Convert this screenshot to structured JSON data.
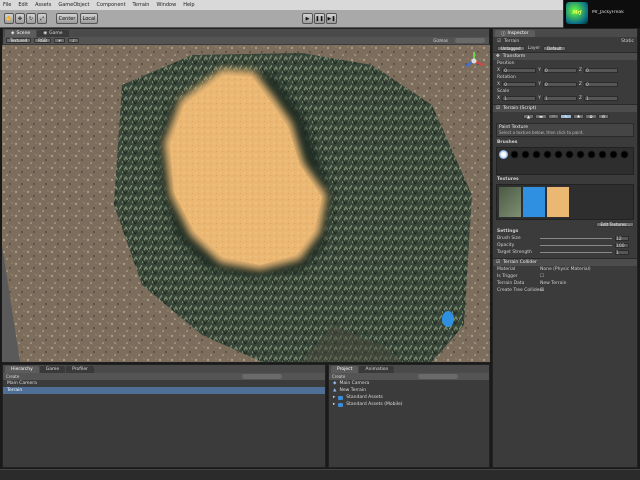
{
  "menu": [
    "File",
    "Edit",
    "Assets",
    "GameObject",
    "Component",
    "Terrain",
    "Window",
    "Help"
  ],
  "toolbar": {
    "tools": [
      "hand",
      "move",
      "rotate",
      "scale"
    ],
    "pivot_label": "Center",
    "space_label": "Local",
    "play_controls": [
      "play",
      "pause",
      "step"
    ]
  },
  "user": {
    "logo_text": "MrJ",
    "name": "Mr_JackyFreak"
  },
  "scene": {
    "tabs": [
      "Scene",
      "Game"
    ],
    "shading_mode": "Textured",
    "render_mode": "RGB",
    "gizmos_label": "Gizmos"
  },
  "inspector": {
    "tab": "Inspector",
    "object_name": "Terrain",
    "static_label": "Static",
    "tag_label": "Untagged",
    "layer_label": "Layer",
    "layer_value": "Default",
    "transform": {
      "title": "Transform",
      "position_label": "Position",
      "rotation_label": "Rotation",
      "scale_label": "Scale",
      "position": {
        "x": "0",
        "y": "0",
        "z": "0"
      },
      "rotation": {
        "x": "0",
        "y": "0",
        "z": "0"
      },
      "scale": {
        "x": "1",
        "y": "1",
        "z": "1"
      }
    },
    "terrain": {
      "title": "Terrain (Script)",
      "paint_heading": "Paint Texture",
      "paint_help": "Select a texture below, then click to paint.",
      "brushes_heading": "Brushes",
      "textures_heading": "Textures",
      "edit_textures": "Edit Textures...",
      "settings_heading": "Settings",
      "brush_size_label": "Brush Size",
      "brush_size": "12",
      "opacity_label": "Opacity",
      "opacity": "100",
      "target_strength_label": "Target Strength",
      "target_strength": "1"
    },
    "collider": {
      "title": "Terrain Collider",
      "material_label": "Material",
      "material_value": "None (Physic Material)",
      "trigger_label": "Is Trigger",
      "data_label": "Terrain Data",
      "data_value": "New Terrain",
      "trees_label": "Create Tree Colliders"
    }
  },
  "hierarchy": {
    "tabs": [
      "Hierarchy",
      "Game",
      "Profiler"
    ],
    "create_label": "Create",
    "items": [
      "Main Camera",
      "Terrain"
    ]
  },
  "project": {
    "tabs": [
      "Project",
      "Animation"
    ],
    "create_label": "Create",
    "items": [
      "Main Camera",
      "New Terrain",
      "Standard Assets",
      "Standard Assets (Mobile)"
    ]
  },
  "colors": {
    "sand": "#e9b36a",
    "rock": "#3b4a3a",
    "ground": "#7a6a58",
    "water": "#2f8fe0",
    "selection": "#4f6f97"
  }
}
